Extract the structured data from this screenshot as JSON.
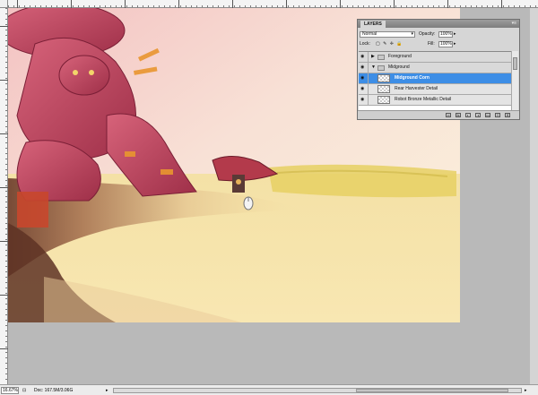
{
  "layers_panel": {
    "tab_label": "LAYERS",
    "menu_icon": "panel-menu-icon",
    "blend_mode": "Normal",
    "opacity_label": "Opacity:",
    "opacity_value": "100%",
    "lock_label": "Lock:",
    "fill_label": "Fill:",
    "fill_value": "100%",
    "layers": [
      {
        "name": "Foreground",
        "type": "group",
        "expanded": false,
        "visible": true
      },
      {
        "name": "Midground",
        "type": "group",
        "expanded": true,
        "visible": true
      },
      {
        "name": "Midground Corn",
        "type": "layer",
        "selected": true,
        "visible": true
      },
      {
        "name": "Rear Harvester Detail",
        "type": "layer",
        "visible": true
      },
      {
        "name": "Robot Bronze Metallic Detail",
        "type": "layer",
        "visible": true
      }
    ],
    "bottom_icons": [
      "link-icon",
      "fx-icon",
      "mask-icon",
      "adjustment-icon",
      "folder-icon",
      "new-layer-icon",
      "trash-icon"
    ]
  },
  "status_bar": {
    "zoom": "16.67%",
    "doc_info": "Doc: 167.5M/3.06G"
  },
  "colors": {
    "selected_layer": "#3d8ee6",
    "workspace": "#b9b9b9"
  }
}
